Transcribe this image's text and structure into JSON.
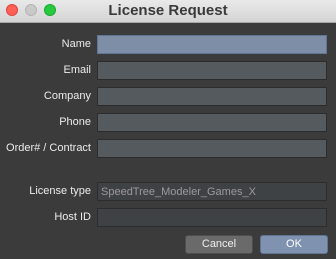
{
  "window": {
    "title": "License Request"
  },
  "form": {
    "fields": [
      {
        "label": "Name",
        "value": ""
      },
      {
        "label": "Email",
        "value": ""
      },
      {
        "label": "Company",
        "value": ""
      },
      {
        "label": "Phone",
        "value": ""
      },
      {
        "label": "Order# / Contract",
        "value": ""
      }
    ],
    "license_type": {
      "label": "License type",
      "value": "SpeedTree_Modeler_Games_X"
    },
    "host_id": {
      "label": "Host ID",
      "value": ""
    }
  },
  "buttons": {
    "cancel_label": "Cancel",
    "ok_label": "OK"
  },
  "colors": {
    "background": "#3b3b3b",
    "active_field": "#7d8ea6",
    "ok_button": "#7f93b0"
  }
}
